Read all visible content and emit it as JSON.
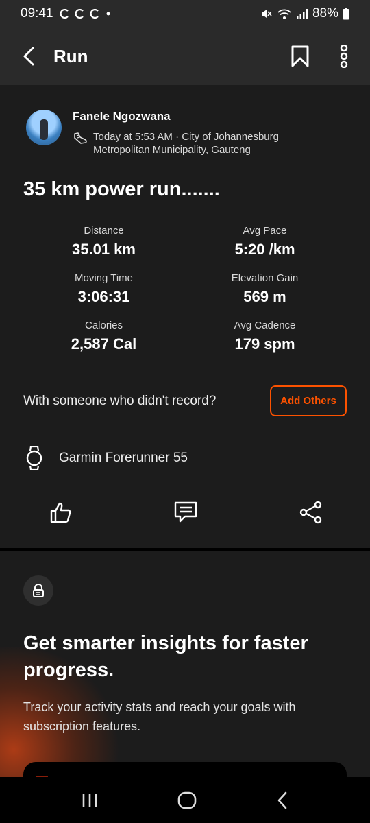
{
  "status_bar": {
    "time": "09:41",
    "battery": "88%",
    "icons": [
      "notification-icon",
      "notification-icon",
      "notification-icon",
      "dot-icon",
      "mute-icon",
      "wifi-icon",
      "signal-icon",
      "battery-icon"
    ]
  },
  "app_bar": {
    "title": "Run",
    "icons": [
      "back-arrow-icon",
      "bookmark-icon",
      "more-vertical-icon"
    ]
  },
  "activity": {
    "athlete_name": "Fanele Ngozwana",
    "meta": "Today at 5:53 AM · City of Johannesburg Metropolitan Municipality, Gauteng",
    "meta_icon": "shoe-icon",
    "title": "35 km power run.......",
    "stats": [
      {
        "label": "Distance",
        "value": "35.01 km"
      },
      {
        "label": "Avg Pace",
        "value": "5:20 /km"
      },
      {
        "label": "Moving Time",
        "value": "3:06:31"
      },
      {
        "label": "Elevation Gain",
        "value": "569 m"
      },
      {
        "label": "Calories",
        "value": "2,587 Cal"
      },
      {
        "label": "Avg Cadence",
        "value": "179 spm"
      }
    ],
    "others_prompt": "With someone who didn't record?",
    "add_others_label": "Add Others",
    "device": "Garmin Forerunner 55",
    "device_icon": "watch-icon",
    "action_icons": [
      "like-icon",
      "comment-icon",
      "share-icon"
    ]
  },
  "insights": {
    "heading": "Get smarter insights for faster progress.",
    "body": "Track your activity stats and reach your goals with subscription features.",
    "icon": "lock-icon"
  },
  "nav_bar": {
    "icons": [
      "recent-apps-icon",
      "home-icon",
      "back-icon"
    ]
  },
  "colors": {
    "accent": "#fc5200",
    "background": "#121212",
    "card": "#1c1c1c",
    "app_bar": "#2a2a2a"
  }
}
